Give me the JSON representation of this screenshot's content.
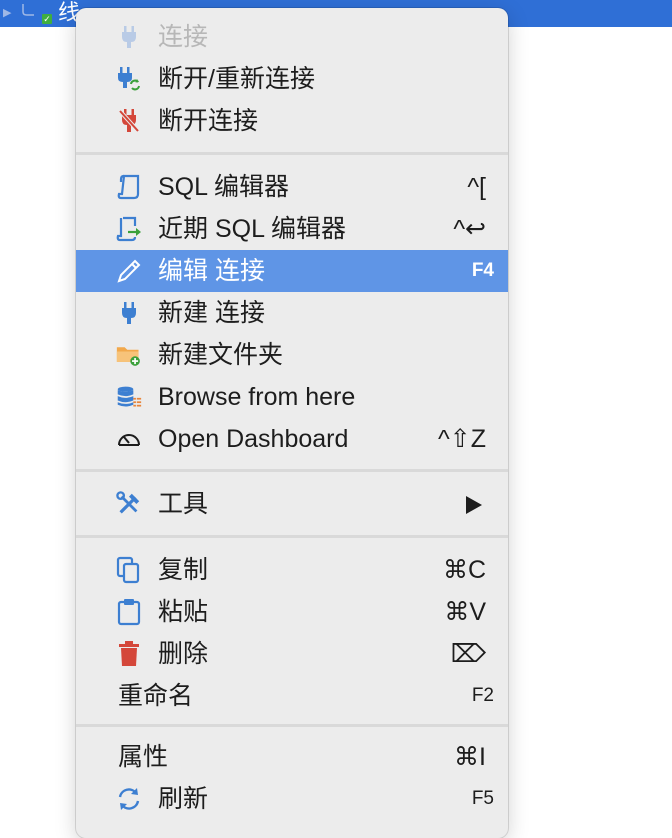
{
  "background_row": {
    "label": "线",
    "highlight_color": "#2f6fd6"
  },
  "menu": {
    "highlight_color": "#5f95e6",
    "items": [
      {
        "label": "连接",
        "icon": "plug-icon",
        "shortcut": "",
        "disabled": true
      },
      {
        "label": "断开/重新连接",
        "icon": "reconnect-icon",
        "shortcut": ""
      },
      {
        "label": "断开连接",
        "icon": "disconnect-icon",
        "shortcut": ""
      },
      {
        "label": "SQL 编辑器",
        "icon": "sql-editor-icon",
        "shortcut": "^["
      },
      {
        "label": "近期 SQL 编辑器",
        "icon": "recent-sql-editor-icon",
        "shortcut": "^↩"
      },
      {
        "label": "编辑 连接",
        "icon": "pencil-icon",
        "shortcut": "F4",
        "highlighted": true
      },
      {
        "label": "新建 连接",
        "icon": "plug-icon",
        "shortcut": ""
      },
      {
        "label": "新建文件夹",
        "icon": "new-folder-icon",
        "shortcut": ""
      },
      {
        "label": "Browse from here",
        "icon": "database-icon",
        "shortcut": ""
      },
      {
        "label": "Open Dashboard",
        "icon": "gauge-icon",
        "shortcut": "^⇧Z"
      },
      {
        "label": "工具",
        "icon": "tools-icon",
        "shortcut": "",
        "submenu": true
      },
      {
        "label": "复制",
        "icon": "copy-icon",
        "shortcut": "⌘C"
      },
      {
        "label": "粘贴",
        "icon": "paste-icon",
        "shortcut": "⌘V"
      },
      {
        "label": "删除",
        "icon": "trash-icon",
        "shortcut": "⌦"
      },
      {
        "label": "重命名",
        "icon": "",
        "shortcut": "F2"
      },
      {
        "label": "属性",
        "icon": "",
        "shortcut": "⌘I"
      },
      {
        "label": "刷新",
        "icon": "refresh-icon",
        "shortcut": "F5"
      }
    ]
  }
}
